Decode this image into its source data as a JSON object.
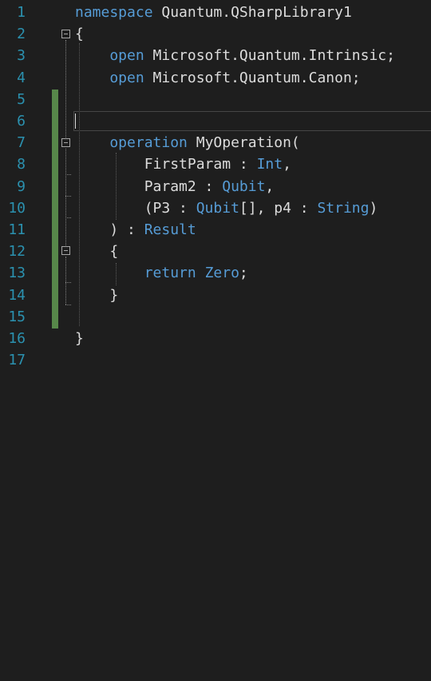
{
  "editor": {
    "line_numbers": [
      "1",
      "2",
      "3",
      "4",
      "5",
      "6",
      "7",
      "8",
      "9",
      "10",
      "11",
      "12",
      "13",
      "14",
      "15",
      "16",
      "17"
    ],
    "lines": [
      [
        {
          "t": "namespace",
          "c": "kw"
        },
        {
          "t": " Quantum.QSharpLibrary1",
          "c": "tx"
        }
      ],
      [
        {
          "t": "{",
          "c": "tx"
        }
      ],
      [
        {
          "t": "    open",
          "c": "kw"
        },
        {
          "t": " Microsoft.Quantum.Intrinsic;",
          "c": "tx"
        }
      ],
      [
        {
          "t": "    open",
          "c": "kw"
        },
        {
          "t": " Microsoft.Quantum.Canon;",
          "c": "tx"
        }
      ],
      [],
      [],
      [
        {
          "t": "    operation",
          "c": "kw"
        },
        {
          "t": " MyOperation(",
          "c": "tx"
        }
      ],
      [
        {
          "t": "        FirstParam : ",
          "c": "tx"
        },
        {
          "t": "Int",
          "c": "kw"
        },
        {
          "t": ",",
          "c": "tx"
        }
      ],
      [
        {
          "t": "        Param2 : ",
          "c": "tx"
        },
        {
          "t": "Qubit",
          "c": "kw"
        },
        {
          "t": ",",
          "c": "tx"
        }
      ],
      [
        {
          "t": "        (P3 : ",
          "c": "tx"
        },
        {
          "t": "Qubit",
          "c": "kw"
        },
        {
          "t": "[], p4 : ",
          "c": "tx"
        },
        {
          "t": "String",
          "c": "kw"
        },
        {
          "t": ")",
          "c": "tx"
        }
      ],
      [
        {
          "t": "    ) : ",
          "c": "tx"
        },
        {
          "t": "Result",
          "c": "kw"
        }
      ],
      [
        {
          "t": "    {",
          "c": "tx"
        }
      ],
      [
        {
          "t": "        return",
          "c": "kw"
        },
        {
          "t": " ",
          "c": "tx"
        },
        {
          "t": "Zero",
          "c": "kw"
        },
        {
          "t": ";",
          "c": "tx"
        }
      ],
      [
        {
          "t": "    }",
          "c": "tx"
        }
      ],
      [],
      [
        {
          "t": "}",
          "c": "tx"
        }
      ],
      []
    ],
    "colors": {
      "background": "#1e1e1e",
      "line_number": "#2b91af",
      "keyword": "#569cd6",
      "text": "#dcdcdc",
      "change_bar": "#57874a"
    },
    "fold_icons": [
      "collapse-icon-line-2",
      "collapse-icon-line-7",
      "collapse-icon-line-12"
    ]
  }
}
